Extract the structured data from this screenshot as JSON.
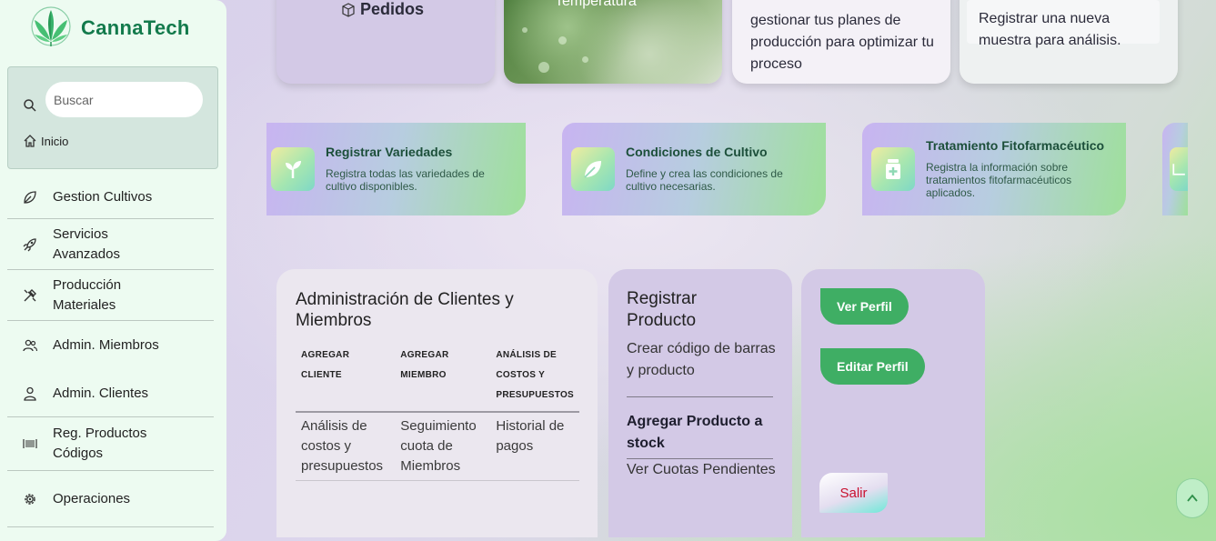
{
  "brand": {
    "name": "CannaTech"
  },
  "search": {
    "placeholder": "Buscar",
    "home_label": "Inicio"
  },
  "sidebar": {
    "items": [
      {
        "label": "Gestion Cultivos",
        "icon": "leaf-icon"
      },
      {
        "label": "Servicios Avanzados",
        "icon": "rocket-icon"
      },
      {
        "label": "Producción Materiales",
        "icon": "tools-icon"
      },
      {
        "label": "Admin. Miembros",
        "icon": "people-icon"
      },
      {
        "label": "Admin. Clientes",
        "icon": "person-icon"
      },
      {
        "label": "Reg. Productos Códigos",
        "icon": "barcode-icon"
      },
      {
        "label": "Operaciones",
        "icon": "gear-icon"
      }
    ]
  },
  "top_cards": {
    "pedidos": "Pedidos",
    "temperatura": "Temperatura",
    "plan": "gestionar tus planes de producción para optimizar tu proceso",
    "muestra": "Registrar una nueva muestra para análisis."
  },
  "services": [
    {
      "title": "Registrar Variedades",
      "desc": "Registra todas las variedades de cultivo disponibles.",
      "icon": "sprout-icon"
    },
    {
      "title": "Condiciones de Cultivo",
      "desc": "Define y crea las condiciones de cultivo necesarias.",
      "icon": "leaf-icon"
    },
    {
      "title": "Tratamiento Fitofarmacéutico",
      "desc": "Registra la información sobre tratamientos fitofarmacéuticos aplicados.",
      "icon": "medicine-jar-icon"
    }
  ],
  "admin": {
    "title": "Administración de Clientes y Miembros",
    "headers": [
      "AGREGAR CLIENTE",
      "AGREGAR MIEMBRO",
      "ANÁLISIS DE COSTOS Y PRESUPUESTOS"
    ],
    "row": [
      "Análisis de costos y presupuestos",
      "Seguimiento cuota de Miembros",
      "Historial de pagos"
    ]
  },
  "producto": {
    "title": "Registrar Producto",
    "subtitle": "Crear código de barras y producto",
    "stock": "Agregar Producto a stock",
    "cuotas": "Ver Cuotas Pendientes"
  },
  "perfil": {
    "ver": "Ver Perfil",
    "editar": "Editar Perfil",
    "salir": "Salir"
  },
  "colors": {
    "brand": "#137a4c",
    "button_green": "#3fae64",
    "logout_red": "#c8102e",
    "card_lavender": "#d3c9e6"
  }
}
